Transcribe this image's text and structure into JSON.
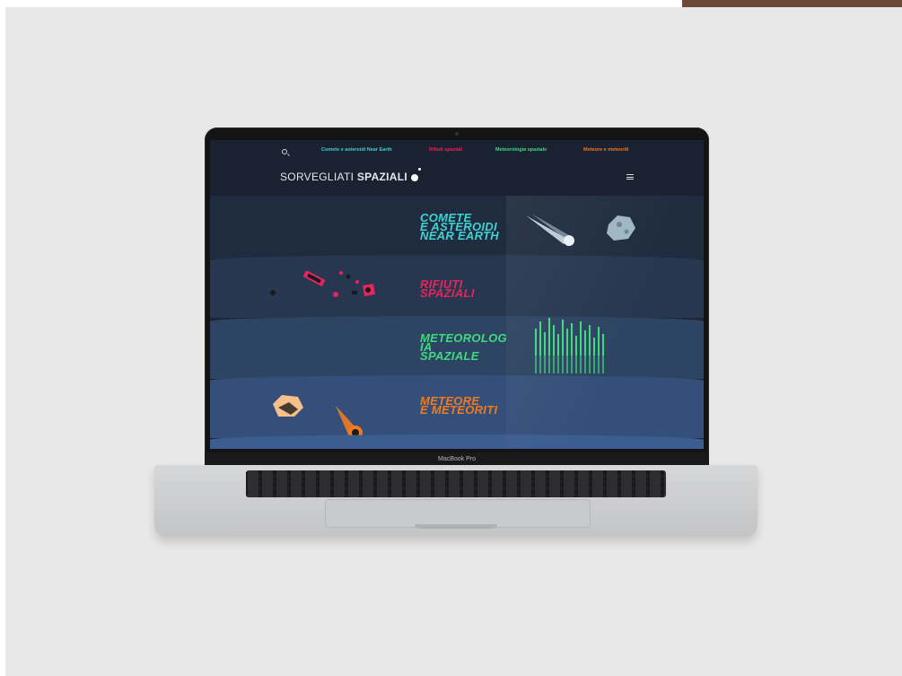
{
  "nav": {
    "items": [
      {
        "label": "Comete e asteroidi Near Earth",
        "color": "#3fd2d0"
      },
      {
        "label": "Rifiuti spaziali",
        "color": "#e6245d"
      },
      {
        "label": "Meteorologia spaziale",
        "color": "#3fd97f"
      },
      {
        "label": "Meteore e meteoriti",
        "color": "#f07a1e"
      }
    ]
  },
  "brand": {
    "light": "SORVEGLIATI ",
    "bold": "SPAZIALI"
  },
  "sections": [
    {
      "title": "COMETE\nE ASTEROIDI\nNEAR EARTH"
    },
    {
      "title": "RIFIUTI\nSPAZIALI"
    },
    {
      "title": "METEOROLOG\nIA\nSPAZIALE"
    },
    {
      "title": "METEORE\nE METEORITI"
    }
  ],
  "device": {
    "label": "MacBook Pro"
  }
}
